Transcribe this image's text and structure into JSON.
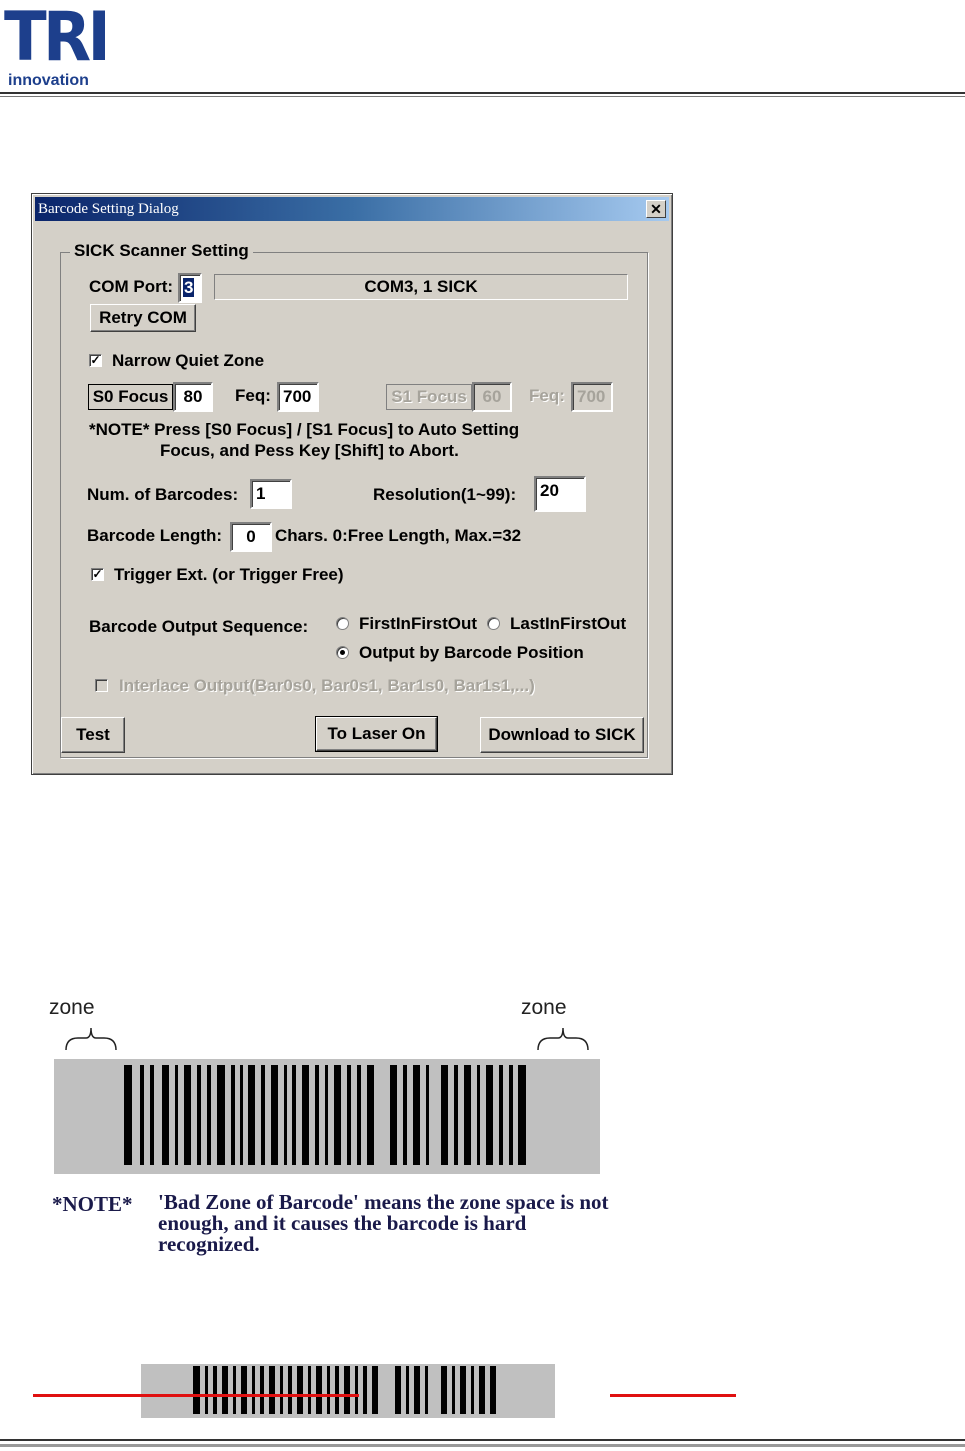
{
  "header": {
    "logo_letters": "TRI",
    "logo_subtitle": "innovation"
  },
  "dialog": {
    "title": "Barcode Setting Dialog",
    "close_symbol": "✕",
    "group_label": "SICK Scanner Setting",
    "com_port_label": "COM Port:",
    "com_port_value": "3",
    "com_status": "COM3, 1 SICK",
    "retry_com_button": "Retry COM",
    "narrow_quiet_zone_label": "Narrow Quiet Zone",
    "narrow_quiet_zone_checked": true,
    "s0_focus_button": "S0 Focus",
    "s0_focus_value": "80",
    "s0_feq_label": "Feq:",
    "s0_feq_value": "700",
    "s1_focus_button": "S1 Focus",
    "s1_focus_value": "60",
    "s1_feq_label": "Feq:",
    "s1_feq_value": "700",
    "note_line1": "*NOTE* Press [S0 Focus] / [S1 Focus] to Auto Setting",
    "note_line2": "Focus, and Pess Key [Shift] to Abort.",
    "num_barcodes_label": "Num. of Barcodes:",
    "num_barcodes_value": "1",
    "resolution_label": "Resolution(1~99):",
    "resolution_value": "20",
    "barcode_length_label": "Barcode Length:",
    "barcode_length_value": "0",
    "barcode_length_hint": "Chars. 0:Free Length, Max.=32",
    "trigger_label": "Trigger Ext. (or Trigger Free)",
    "trigger_checked": true,
    "output_sequence_label": "Barcode Output Sequence:",
    "radio_fifo": "FirstInFirstOut",
    "radio_lifo": "LastInFirstOut",
    "radio_position": "Output by Barcode Position",
    "selected_sequence": "Output by Barcode Position",
    "interlace_label": "Interlace Output(Bar0s0, Bar0s1, Bar1s0, Bar1s1,...)",
    "interlace_checked": false,
    "test_button": "Test",
    "laser_button": "To Laser On",
    "download_button": "Download to SICK"
  },
  "illustration": {
    "zone_left": "zone",
    "zone_right": "zone",
    "note_key": "*NOTE*",
    "note_text": "'Bad Zone of Barcode' means the zone space is not enough, and it causes the barcode is hard recognized.",
    "colors": {
      "barcode_bg": "#c0c0c0",
      "bar": "#000000",
      "laser": "#e01010"
    }
  }
}
